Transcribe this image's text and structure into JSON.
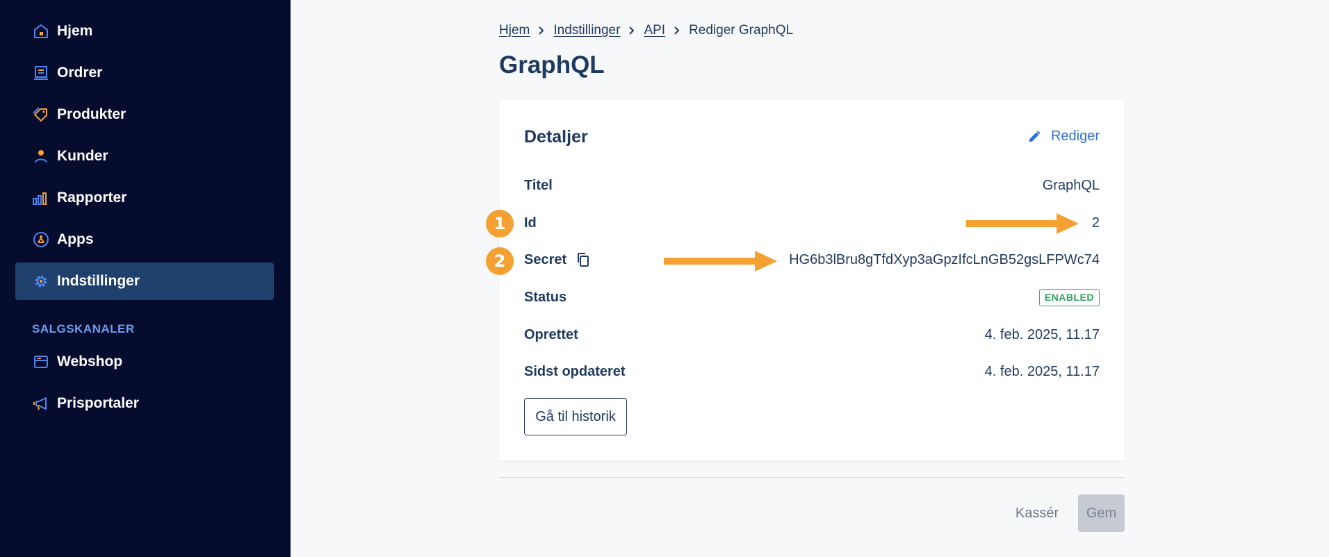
{
  "sidebar": {
    "items": [
      {
        "label": "Hjem",
        "icon": "home-icon"
      },
      {
        "label": "Ordrer",
        "icon": "orders-icon"
      },
      {
        "label": "Produkter",
        "icon": "tag-icon"
      },
      {
        "label": "Kunder",
        "icon": "user-icon"
      },
      {
        "label": "Rapporter",
        "icon": "bar-chart-icon"
      },
      {
        "label": "Apps",
        "icon": "apps-icon"
      },
      {
        "label": "Indstillinger",
        "icon": "gear-icon",
        "active": true
      }
    ],
    "section_label": "SALGSKANALER",
    "channels": [
      {
        "label": "Webshop",
        "icon": "storefront-icon"
      },
      {
        "label": "Prisportaler",
        "icon": "megaphone-icon"
      }
    ]
  },
  "breadcrumb": {
    "items": [
      "Hjem",
      "Indstillinger",
      "API"
    ],
    "current": "Rediger GraphQL"
  },
  "page": {
    "title": "GraphQL"
  },
  "details": {
    "title": "Detaljer",
    "edit_label": "Rediger",
    "rows": {
      "title": {
        "key": "Titel",
        "value": "GraphQL"
      },
      "id": {
        "key": "Id",
        "value": "2"
      },
      "secret": {
        "key": "Secret",
        "value": "HG6b3lBru8gTfdXyp3aGpzIfcLnGB52gsLFPWc74"
      },
      "status": {
        "key": "Status",
        "value": "ENABLED"
      },
      "created": {
        "key": "Oprettet",
        "value": "4. feb. 2025, 11.17"
      },
      "updated": {
        "key": "Sidst opdateret",
        "value": "4. feb. 2025, 11.17"
      }
    },
    "history_button": "Gå til historik"
  },
  "footer": {
    "discard": "Kassér",
    "save": "Gem"
  },
  "annotations": {
    "marker_1": "1",
    "marker_2": "2"
  },
  "colors": {
    "sidebar_bg": "#060c2e",
    "active_item": "#1f3f6c",
    "accent_orange": "#f5a033",
    "link_blue": "#2f6fdc",
    "status_green": "#37b26a"
  }
}
